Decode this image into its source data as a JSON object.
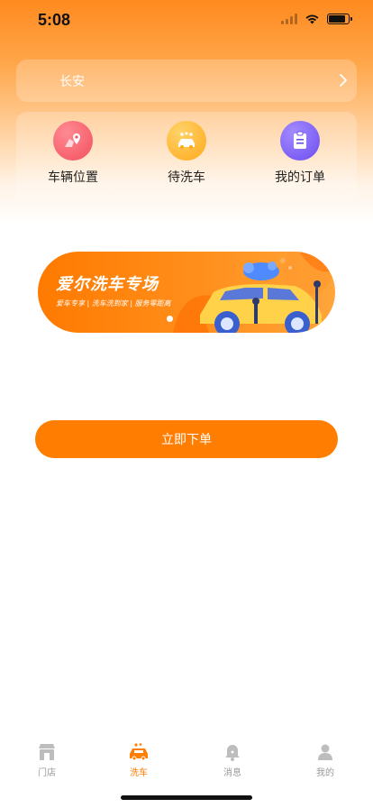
{
  "status_bar": {
    "time": "5:08",
    "battery_level": 0.85
  },
  "location": {
    "city": "长安"
  },
  "quick_actions": [
    {
      "label": "车辆位置",
      "icon": "map-pin-icon",
      "color": "#f45b69"
    },
    {
      "label": "待洗车",
      "icon": "car-wash-icon",
      "color": "#ffb020"
    },
    {
      "label": "我的订单",
      "icon": "clipboard-icon",
      "color": "#7a5cf5"
    }
  ],
  "banner": {
    "title": "爱尔洗车专场",
    "subtitle": "爱车专享 | 洗车洗到家 | 服务零距离",
    "active_slide": 1,
    "slide_count": 1
  },
  "order_button": {
    "label": "立即下单"
  },
  "tabbar": {
    "active": "洗车",
    "accent": "#ff7d00",
    "items": [
      {
        "label": "门店",
        "icon": "store-icon"
      },
      {
        "label": "洗车",
        "icon": "car-icon"
      },
      {
        "label": "消息",
        "icon": "bell-icon"
      },
      {
        "label": "我的",
        "icon": "user-icon"
      }
    ]
  }
}
